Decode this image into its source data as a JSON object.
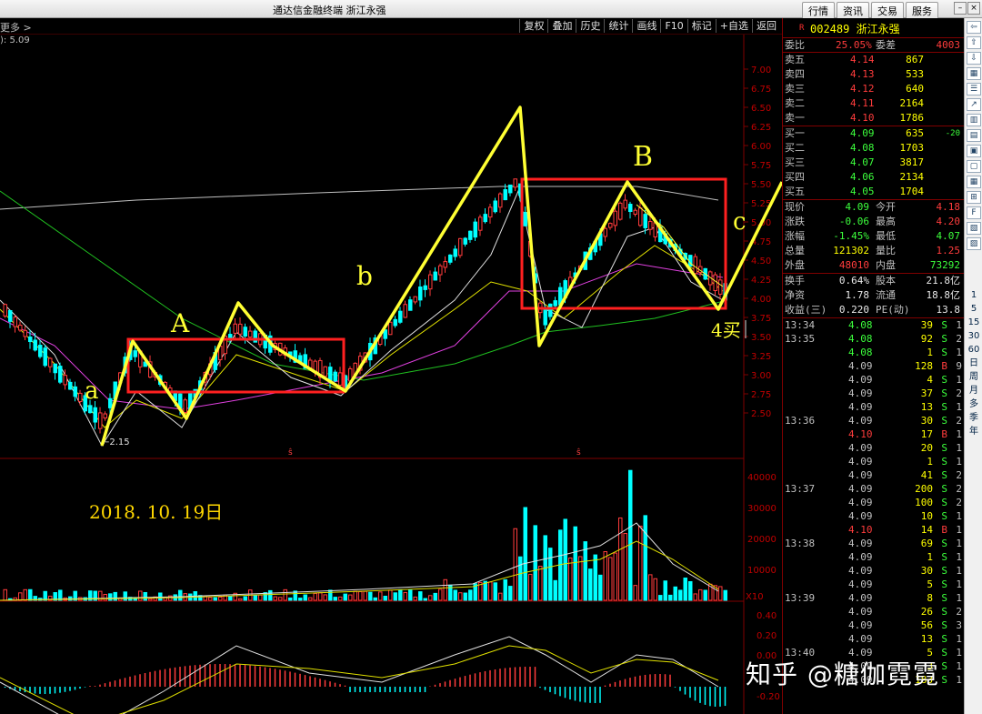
{
  "window": {
    "title": "通达信金融终端  浙江永强",
    "menu": [
      "行情",
      "资讯",
      "交易",
      "服务"
    ]
  },
  "toolbar": {
    "left_label": "更多 >",
    "buttons": [
      "复权",
      "叠加",
      "历史",
      "统计",
      "画线",
      "F10",
      "标记",
      "+自选",
      "返回"
    ],
    "sub_label": "5.09"
  },
  "price_axis": [
    "7.00",
    "6.75",
    "6.50",
    "6.25",
    "6.00",
    "5.75",
    "5.50",
    "5.25",
    "5.00",
    "4.75",
    "4.50",
    "4.25",
    "4.00",
    "3.75",
    "3.50",
    "3.25",
    "3.00",
    "2.75",
    "2.50"
  ],
  "volume_axis": [
    "40000",
    "30000",
    "20000",
    "10000"
  ],
  "volume_unit": "X10",
  "macd_axis": [
    "0.40",
    "0.20",
    "0.00",
    "-0.20"
  ],
  "low_marker": "2.15",
  "annotations": {
    "a": "a",
    "A": "A",
    "b": "b",
    "B": "B",
    "c": "c",
    "buy": "4买",
    "date": "2018. 10. 19日"
  },
  "watermark": "知乎 @糖伽霓霓",
  "quote": {
    "flag": "R",
    "code": "002489",
    "name": "浙江永强",
    "weibi_label": "委比",
    "weibi": "25.05%",
    "weicha_label": "委差",
    "weicha": "4003",
    "asks": [
      {
        "label": "卖五",
        "price": "4.14",
        "vol": "867"
      },
      {
        "label": "卖四",
        "price": "4.13",
        "vol": "533"
      },
      {
        "label": "卖三",
        "price": "4.12",
        "vol": "640"
      },
      {
        "label": "卖二",
        "price": "4.11",
        "vol": "2164"
      },
      {
        "label": "卖一",
        "price": "4.10",
        "vol": "1786"
      }
    ],
    "bids": [
      {
        "label": "买一",
        "price": "4.09",
        "vol": "635",
        "chg": "-20"
      },
      {
        "label": "买二",
        "price": "4.08",
        "vol": "1703",
        "chg": ""
      },
      {
        "label": "买三",
        "price": "4.07",
        "vol": "3817",
        "chg": ""
      },
      {
        "label": "买四",
        "price": "4.06",
        "vol": "2134",
        "chg": ""
      },
      {
        "label": "买五",
        "price": "4.05",
        "vol": "1704",
        "chg": ""
      }
    ],
    "stats": [
      {
        "l1": "现价",
        "v1": "4.09",
        "l2": "今开",
        "v2": "4.18",
        "c1": "grn",
        "c2": "red"
      },
      {
        "l1": "涨跌",
        "v1": "-0.06",
        "l2": "最高",
        "v2": "4.20",
        "c1": "grn",
        "c2": "red"
      },
      {
        "l1": "涨幅",
        "v1": "-1.45%",
        "l2": "最低",
        "v2": "4.07",
        "c1": "grn",
        "c2": "grn"
      },
      {
        "l1": "总量",
        "v1": "121302",
        "l2": "量比",
        "v2": "1.25",
        "c1": "yel",
        "c2": "red"
      },
      {
        "l1": "外盘",
        "v1": "48010",
        "l2": "内盘",
        "v2": "73292",
        "c1": "red",
        "c2": "grn"
      }
    ],
    "stats2": [
      {
        "l1": "换手",
        "v1": "0.64%",
        "l2": "股本",
        "v2": "21.8亿"
      },
      {
        "l1": "净资",
        "v1": "1.78",
        "l2": "流通",
        "v2": "18.8亿"
      },
      {
        "l1": "收益(三)",
        "v1": "0.220",
        "l2": "PE(动)",
        "v2": "13.8"
      }
    ],
    "ticks": [
      {
        "t": "13:34",
        "p": "4.08",
        "v": "39",
        "s": "S",
        "n": "1"
      },
      {
        "t": "13:35",
        "p": "4.08",
        "v": "92",
        "s": "S",
        "n": "2"
      },
      {
        "t": "",
        "p": "4.08",
        "v": "1",
        "s": "S",
        "n": "1"
      },
      {
        "t": "",
        "p": "4.09",
        "v": "128",
        "s": "B",
        "n": "9"
      },
      {
        "t": "",
        "p": "4.09",
        "v": "4",
        "s": "S",
        "n": "1"
      },
      {
        "t": "",
        "p": "4.09",
        "v": "37",
        "s": "S",
        "n": "2"
      },
      {
        "t": "",
        "p": "4.09",
        "v": "13",
        "s": "S",
        "n": "1"
      },
      {
        "t": "13:36",
        "p": "4.09",
        "v": "30",
        "s": "S",
        "n": "2"
      },
      {
        "t": "",
        "p": "4.10",
        "v": "17",
        "s": "B",
        "n": "1"
      },
      {
        "t": "",
        "p": "4.09",
        "v": "20",
        "s": "S",
        "n": "1"
      },
      {
        "t": "",
        "p": "4.09",
        "v": "1",
        "s": "S",
        "n": "1"
      },
      {
        "t": "",
        "p": "4.09",
        "v": "41",
        "s": "S",
        "n": "2"
      },
      {
        "t": "13:37",
        "p": "4.09",
        "v": "200",
        "s": "S",
        "n": "2"
      },
      {
        "t": "",
        "p": "4.09",
        "v": "100",
        "s": "S",
        "n": "2"
      },
      {
        "t": "",
        "p": "4.09",
        "v": "10",
        "s": "S",
        "n": "1"
      },
      {
        "t": "",
        "p": "4.10",
        "v": "14",
        "s": "B",
        "n": "1"
      },
      {
        "t": "13:38",
        "p": "4.09",
        "v": "69",
        "s": "S",
        "n": "1"
      },
      {
        "t": "",
        "p": "4.09",
        "v": "1",
        "s": "S",
        "n": "1"
      },
      {
        "t": "",
        "p": "4.09",
        "v": "30",
        "s": "S",
        "n": "1"
      },
      {
        "t": "",
        "p": "4.09",
        "v": "5",
        "s": "S",
        "n": "1"
      },
      {
        "t": "13:39",
        "p": "4.09",
        "v": "8",
        "s": "S",
        "n": "1"
      },
      {
        "t": "",
        "p": "4.09",
        "v": "26",
        "s": "S",
        "n": "2"
      },
      {
        "t": "",
        "p": "4.09",
        "v": "56",
        "s": "S",
        "n": "3"
      },
      {
        "t": "",
        "p": "4.09",
        "v": "13",
        "s": "S",
        "n": "1"
      },
      {
        "t": "13:40",
        "p": "4.09",
        "v": "5",
        "s": "S",
        "n": "1"
      },
      {
        "t": "",
        "p": "4.09",
        "v": "3",
        "s": "S",
        "n": "1"
      },
      {
        "t": "",
        "p": "4.09",
        "v": "183",
        "s": "S",
        "n": "1"
      }
    ]
  },
  "right_tools_text": [
    "1",
    "5",
    "15",
    "30",
    "60",
    "日",
    "周",
    "月",
    "多",
    "季",
    "年"
  ],
  "colors": {
    "up": "#ff3c3c",
    "down": "#00ffff",
    "annotation": "#ffff33",
    "box": "#ff2020"
  }
}
